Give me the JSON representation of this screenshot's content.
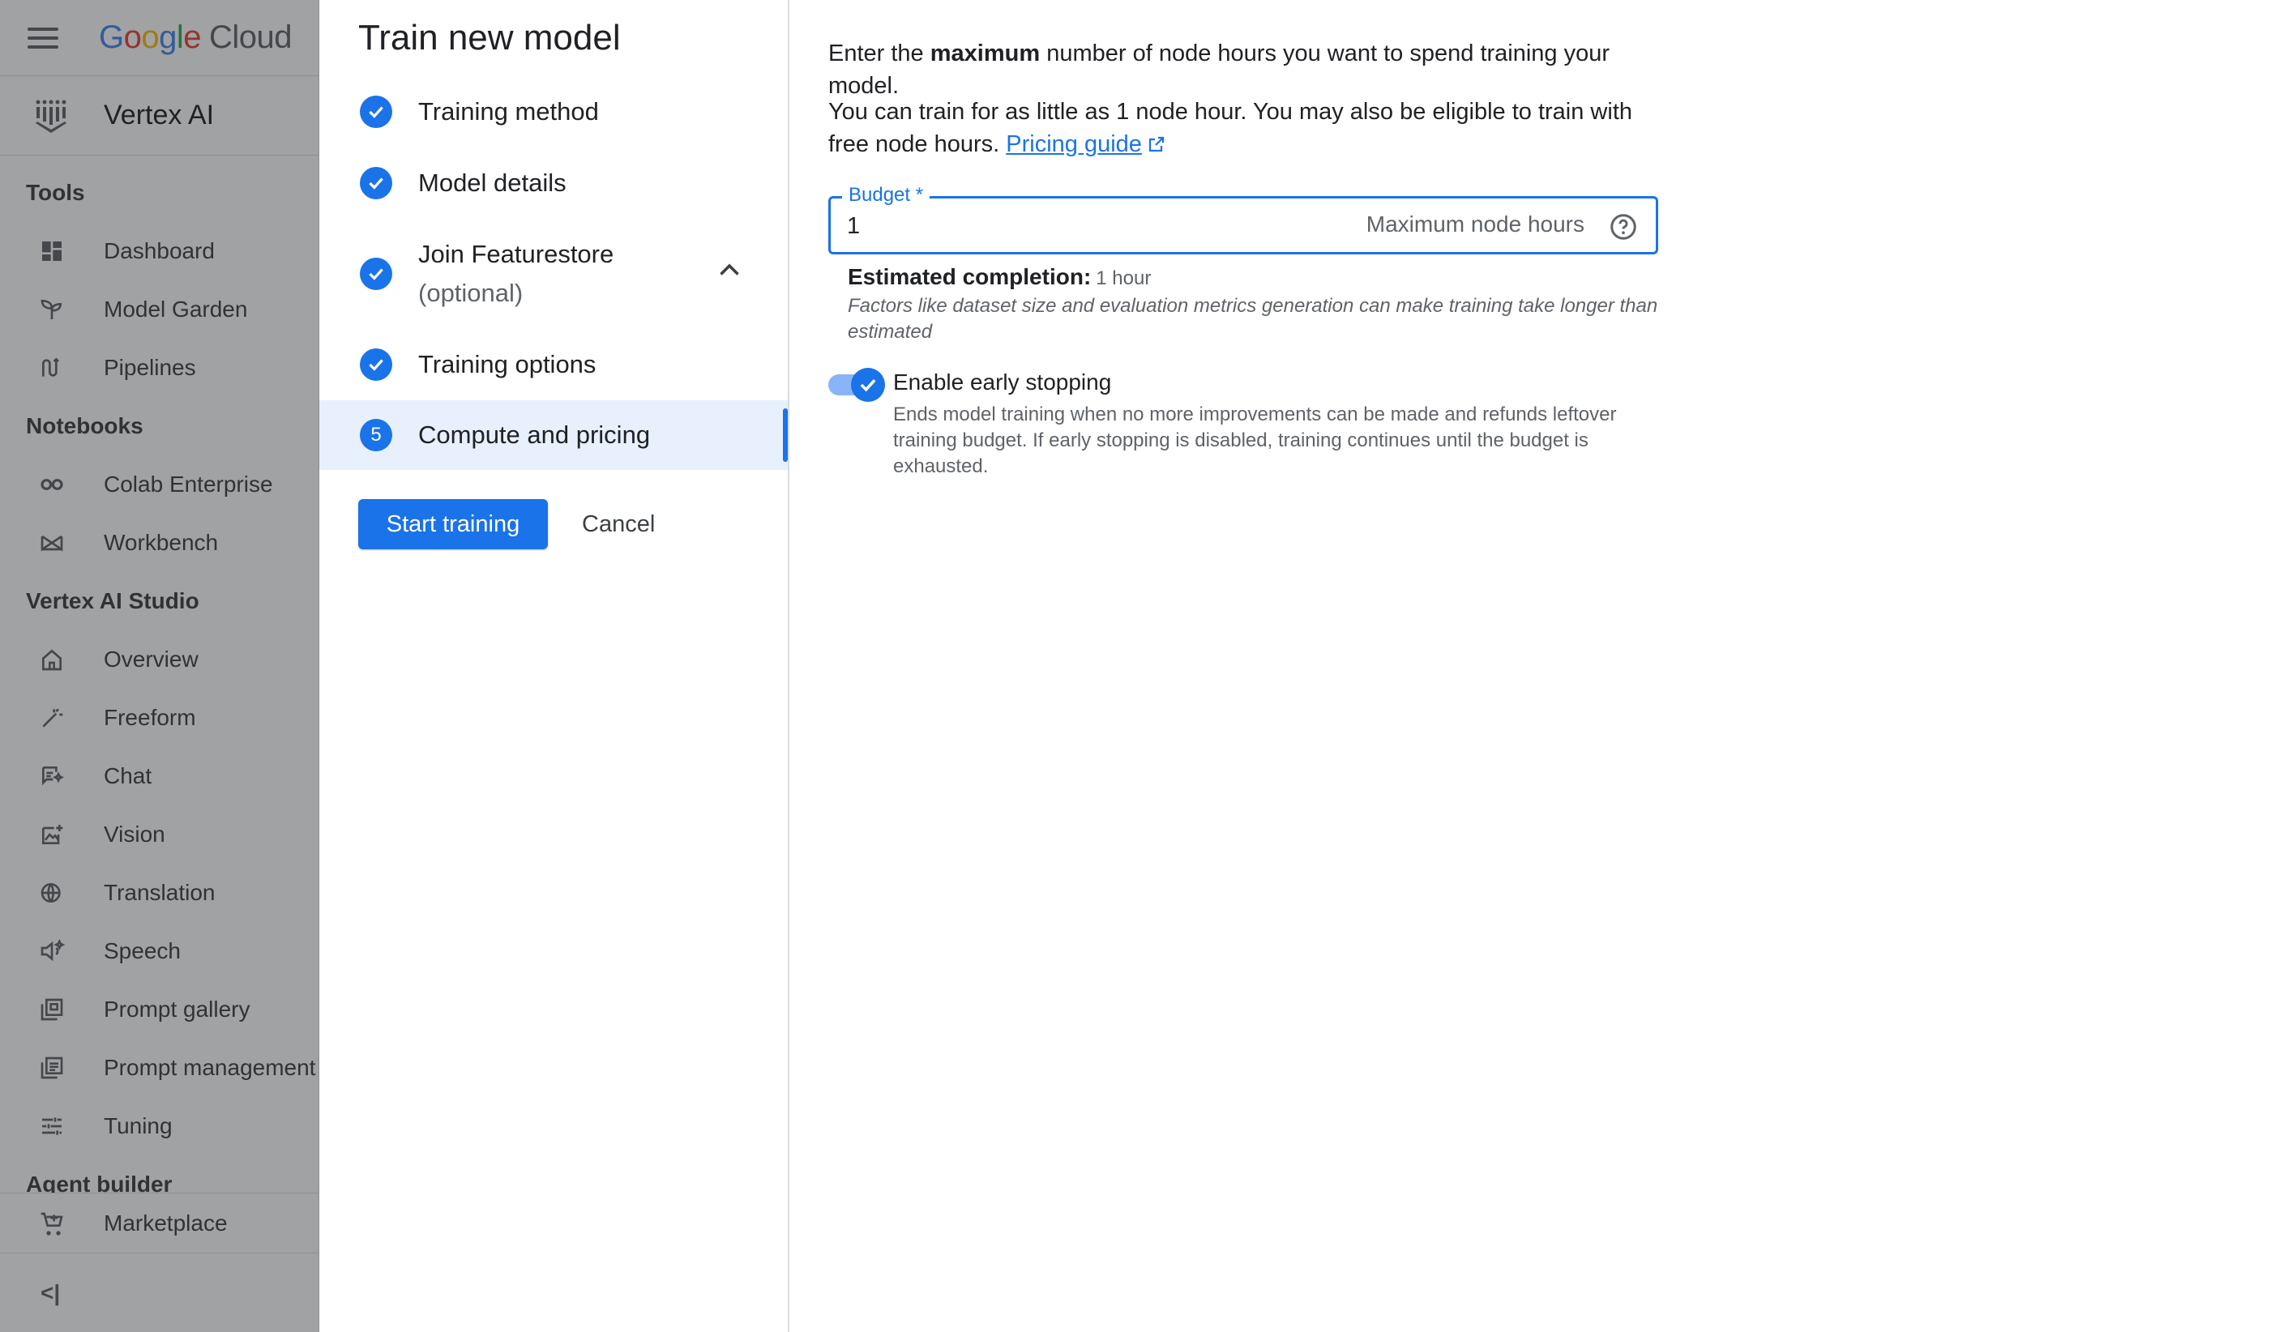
{
  "nav": {
    "brand_parts": [
      "G",
      "o",
      "o",
      "g",
      "l",
      "e"
    ],
    "brand_suffix": "Cloud",
    "product": "Vertex AI",
    "sections": [
      {
        "title": "Tools",
        "items": [
          {
            "label": "Dashboard",
            "icon": "dashboard-icon"
          },
          {
            "label": "Model Garden",
            "icon": "sprout-icon"
          },
          {
            "label": "Pipelines",
            "icon": "pipelines-icon"
          }
        ]
      },
      {
        "title": "Notebooks",
        "items": [
          {
            "label": "Colab Enterprise",
            "icon": "colab-icon"
          },
          {
            "label": "Workbench",
            "icon": "workbench-icon"
          }
        ]
      },
      {
        "title": "Vertex AI Studio",
        "items": [
          {
            "label": "Overview",
            "icon": "home-icon"
          },
          {
            "label": "Freeform",
            "icon": "freeform-icon"
          },
          {
            "label": "Chat",
            "icon": "chat-icon"
          },
          {
            "label": "Vision",
            "icon": "vision-icon"
          },
          {
            "label": "Translation",
            "icon": "translation-icon"
          },
          {
            "label": "Speech",
            "icon": "speech-icon"
          },
          {
            "label": "Prompt gallery",
            "icon": "prompt-gallery-icon"
          },
          {
            "label": "Prompt management",
            "icon": "prompt-management-icon"
          },
          {
            "label": "Tuning",
            "icon": "tuning-icon"
          }
        ]
      },
      {
        "title": "Agent builder",
        "items": []
      }
    ],
    "marketplace": "Marketplace",
    "collapse": "<|"
  },
  "stepper": {
    "title": "Train new model",
    "steps": [
      {
        "label": "Training method",
        "status": "done"
      },
      {
        "label": "Model details",
        "status": "done"
      },
      {
        "label": "Join Featurestore",
        "sub": "(optional)",
        "status": "done"
      },
      {
        "label": "Training options",
        "status": "done"
      },
      {
        "label": "Compute and pricing",
        "status": "active",
        "number": "5"
      }
    ],
    "start_label": "Start training",
    "cancel_label": "Cancel"
  },
  "content": {
    "intro_pre": "Enter the ",
    "intro_bold": "maximum",
    "intro_post": " number of node hours you want to spend training your model.",
    "min_text": "You can train for as little as 1 node hour. You may also be eligible to train with free node hours.",
    "pricing_link": "Pricing guide",
    "budget": {
      "label": "Budget *",
      "value": "1",
      "suffix": "Maximum node hours"
    },
    "estimate_label": "Estimated completion:",
    "estimate_value": "1 hour",
    "estimate_note": "Factors like dataset size and evaluation metrics generation can make training take longer than estimated",
    "early_stopping": {
      "label": "Enable early stopping",
      "enabled": true,
      "description": "Ends model training when no more improvements can be made and refunds leftover training budget. If early stopping is disabled, training continues until the budget is exhausted."
    }
  },
  "colors": {
    "accent": "#1a73e8",
    "active_bg": "#e8f0fe",
    "overlay": "#202124"
  }
}
